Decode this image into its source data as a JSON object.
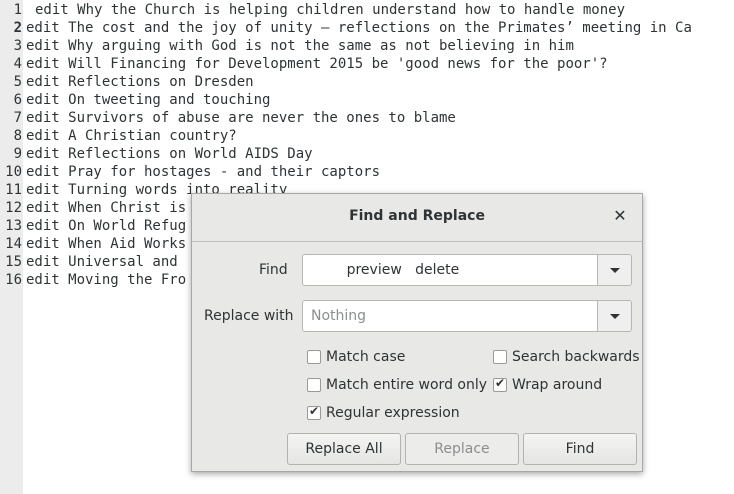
{
  "editor": {
    "lines": [
      {
        "num": "1",
        "text": "edit Why the Church is helping children understand how to handle money"
      },
      {
        "num": "2",
        "text": "edit The cost and the joy of unity – reflections on the Primates’ meeting in Ca"
      },
      {
        "num": "3",
        "text": "edit Why arguing with God is not the same as not believing in him"
      },
      {
        "num": "4",
        "text": "edit Will Financing for Development 2015 be 'good news for the poor'?"
      },
      {
        "num": "5",
        "text": "edit Reflections on Dresden"
      },
      {
        "num": "6",
        "text": "edit On tweeting and touching"
      },
      {
        "num": "7",
        "text": "edit Survivors of abuse are never the ones to blame"
      },
      {
        "num": "8",
        "text": "edit A Christian country?"
      },
      {
        "num": "9",
        "text": "edit Reflections on World AIDS Day"
      },
      {
        "num": "10",
        "text": "edit Pray for hostages - and their captors"
      },
      {
        "num": "11",
        "text": "edit Turning words into reality"
      },
      {
        "num": "12",
        "text": "edit When Christ is"
      },
      {
        "num": "13",
        "text": "edit On World Refug"
      },
      {
        "num": "14",
        "text": "edit When Aid Works"
      },
      {
        "num": "15",
        "text": "edit Universal and"
      },
      {
        "num": "16",
        "text": "edit Moving the Fro"
      }
    ]
  },
  "dialog": {
    "title": "Find and Replace",
    "close_icon": "close-icon",
    "find_label": "Find",
    "find_value": "        preview   delete",
    "replace_label": "Replace with",
    "replace_placeholder": "Nothing",
    "options": {
      "match_case": {
        "label": "Match case",
        "checked": false
      },
      "search_backwards": {
        "label": "Search backwards",
        "checked": false
      },
      "match_entire_word": {
        "label": "Match entire word only",
        "checked": false
      },
      "wrap_around": {
        "label": "Wrap around",
        "checked": true
      },
      "regular_expression": {
        "label": "Regular expression",
        "checked": true
      }
    },
    "buttons": {
      "replace_all": "Replace All",
      "replace": "Replace",
      "find": "Find"
    }
  }
}
